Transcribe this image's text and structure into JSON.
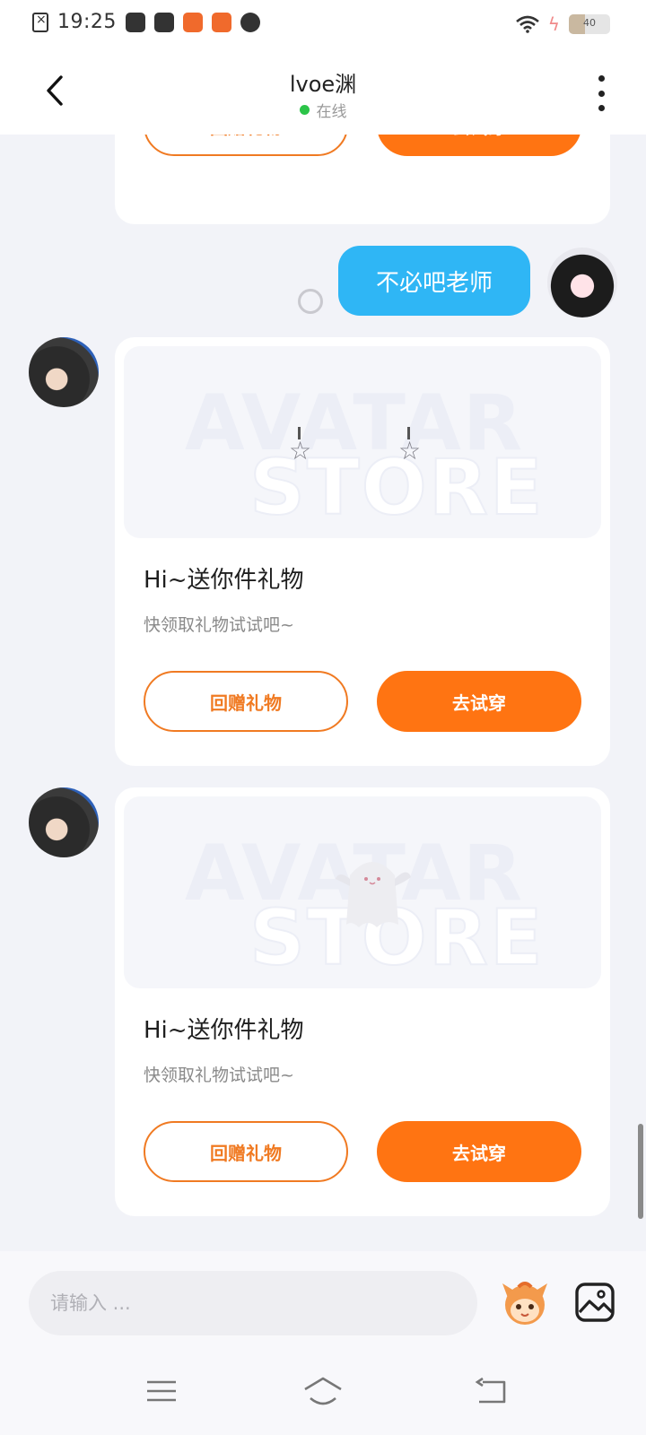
{
  "status_bar": {
    "time": "19:25",
    "battery": "40"
  },
  "header": {
    "title": "lvoe渊",
    "status": "在线"
  },
  "chat": {
    "top_card": {
      "gift_back_label": "回赠礼物",
      "try_on_label": "去试穿"
    },
    "outgoing_message": "不必吧老师",
    "cards": [
      {
        "title": "Hi~送你件礼物",
        "subtitle": "快领取礼物试试吧~",
        "gift_back_label": "回赠礼物",
        "try_on_label": "去试穿",
        "watermark_top": "AVATAR",
        "watermark_bottom": "STORE"
      },
      {
        "title": "Hi~送你件礼物",
        "subtitle": "快领取礼物试试吧~",
        "gift_back_label": "回赠礼物",
        "try_on_label": "去试穿",
        "watermark_top": "AVATAR",
        "watermark_bottom": "STORE"
      }
    ]
  },
  "input": {
    "placeholder": "请输入 ..."
  },
  "icons": {
    "back": "chevron-left-icon",
    "more": "more-vertical-icon",
    "emoji": "emoji-mascot-icon",
    "image": "image-icon",
    "nav_menu": "menu-icon",
    "nav_home": "home-icon",
    "nav_back": "back-icon"
  },
  "colors": {
    "accent_orange": "#ff7412",
    "bubble_blue": "#2fb6f5",
    "online_green": "#2bc448"
  }
}
